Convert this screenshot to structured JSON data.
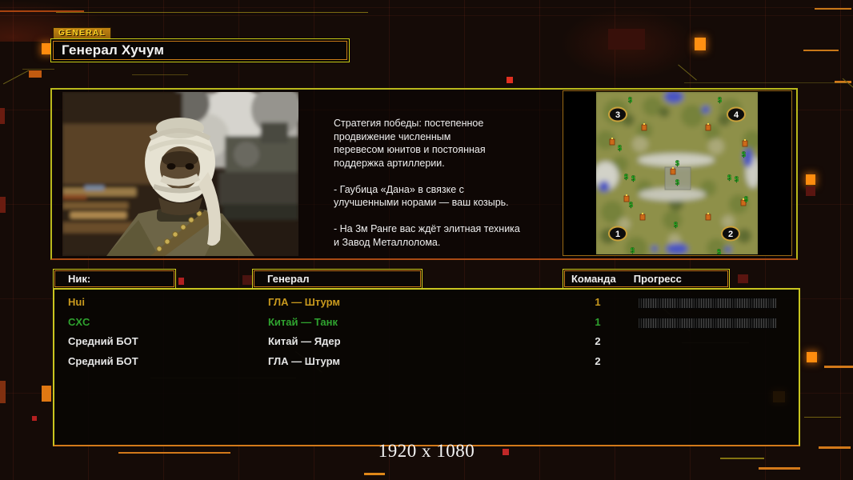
{
  "header": {
    "badge": "GENERAL",
    "title": "Генерал Хучум"
  },
  "briefing": {
    "text": "Стратегия победы: постепенное\nпродвижение численным\nперевесом юнитов и постоянная\nподдержка артиллерии.\n\n- Гаубица «Дана» в связке с\nулучшенными норами — ваш козырь.\n\n- На 3м Ранге вас ждёт элитная техника\nи Завод Металлолома."
  },
  "map": {
    "start_positions": [
      "1",
      "2",
      "3",
      "4"
    ],
    "supply_glyph": "$"
  },
  "players": {
    "headers": {
      "nick": "Ник:",
      "general": "Генерал",
      "team": "Команда",
      "progress": "Прогресс"
    },
    "rows": [
      {
        "nick": "Hui",
        "general": "ГЛА — Штурм",
        "team": "1",
        "color": "#c8991e",
        "loading": true
      },
      {
        "nick": "CXC",
        "general": "Китай — Танк",
        "team": "1",
        "color": "#2fa32f",
        "loading": true
      },
      {
        "nick": "Средний БОТ",
        "general": "Китай — Ядер",
        "team": "2",
        "color": "#e6e6e6",
        "loading": false
      },
      {
        "nick": "Средний БОТ",
        "general": "ГЛА — Штурм",
        "team": "2",
        "color": "#e6e6e6",
        "loading": false
      }
    ]
  },
  "footer": {
    "resolution": "1920 x 1080"
  },
  "colors": {
    "background": "#150b07",
    "accent_yellow": "#c9c51f",
    "accent_orange": "#d2791a",
    "badge_gold": "#ffd426",
    "row_gold": "#c8991e",
    "row_green": "#2fa32f",
    "supply_green": "#27e427",
    "map_water_blue": "#4a55c2"
  }
}
